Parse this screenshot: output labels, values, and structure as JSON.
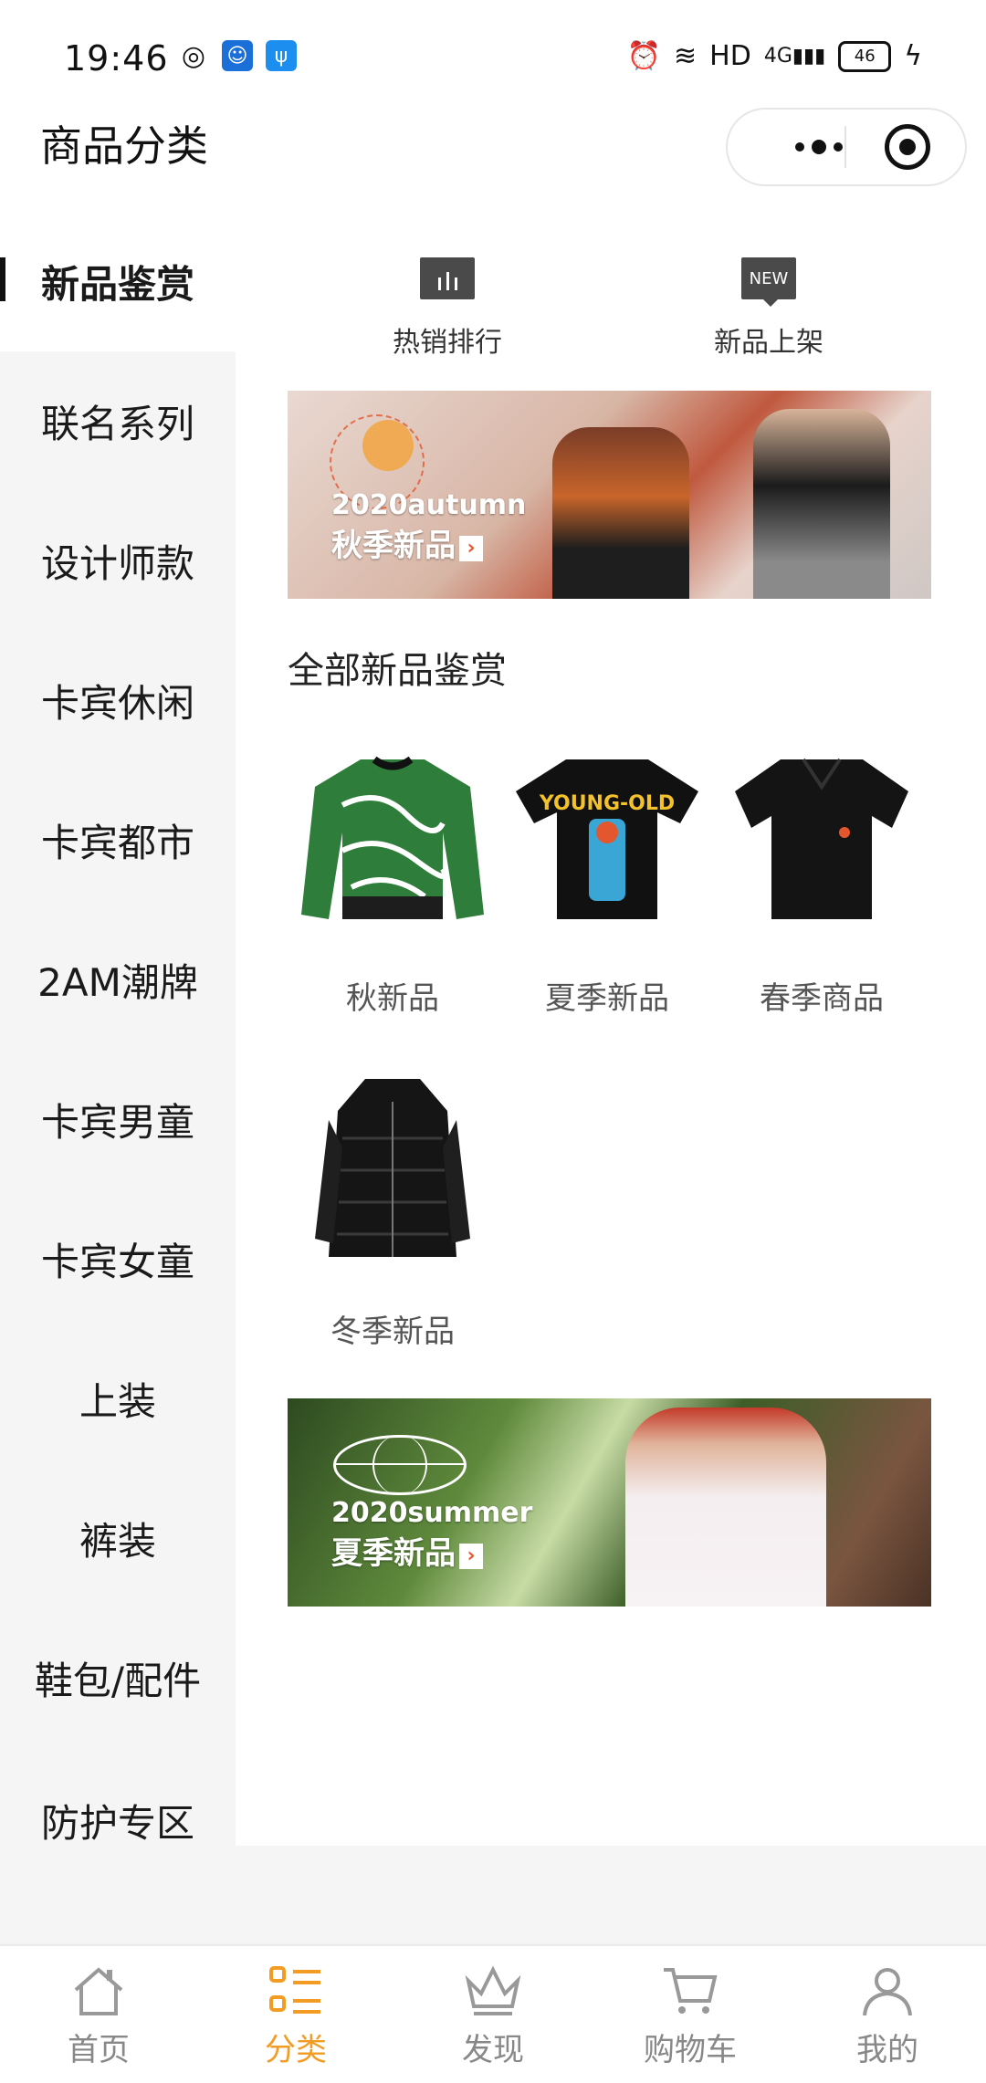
{
  "status_bar": {
    "time": "19:46",
    "network": "HD",
    "signal": "4G",
    "battery": "46"
  },
  "header": {
    "title": "商品分类"
  },
  "sidebar": {
    "items": [
      {
        "label": "新品鉴赏",
        "active": true
      },
      {
        "label": "联名系列"
      },
      {
        "label": "设计师款"
      },
      {
        "label": "卡宾休闲"
      },
      {
        "label": "卡宾都市"
      },
      {
        "label": "2AM潮牌"
      },
      {
        "label": "卡宾男童"
      },
      {
        "label": "卡宾女童"
      },
      {
        "label": "上装"
      },
      {
        "label": "裤装"
      },
      {
        "label": "鞋包/配件"
      },
      {
        "label": "防护专区"
      }
    ]
  },
  "quick_links": [
    {
      "label": "热销排行",
      "icon": "bar-chart-icon"
    },
    {
      "label": "新品上架",
      "icon": "new-badge-icon",
      "badge": "NEW"
    }
  ],
  "banners": [
    {
      "en": "2020autumn",
      "cn": "秋季新品",
      "arrow": "›"
    },
    {
      "en": "2020summer",
      "cn": "夏季新品",
      "arrow": "›"
    }
  ],
  "section_title": "全部新品鉴赏",
  "products": [
    {
      "label": "秋新品"
    },
    {
      "label": "夏季新品"
    },
    {
      "label": "春季商品"
    },
    {
      "label": "冬季新品"
    }
  ],
  "tabs": [
    {
      "label": "首页",
      "icon": "home-icon"
    },
    {
      "label": "分类",
      "icon": "category-icon",
      "active": true
    },
    {
      "label": "发现",
      "icon": "crown-icon"
    },
    {
      "label": "购物车",
      "icon": "cart-icon"
    },
    {
      "label": "我的",
      "icon": "profile-icon"
    }
  ],
  "colors": {
    "accent": "#f39c23",
    "sidebar_bg": "#f5f5f5",
    "tab_inactive": "#888888"
  }
}
